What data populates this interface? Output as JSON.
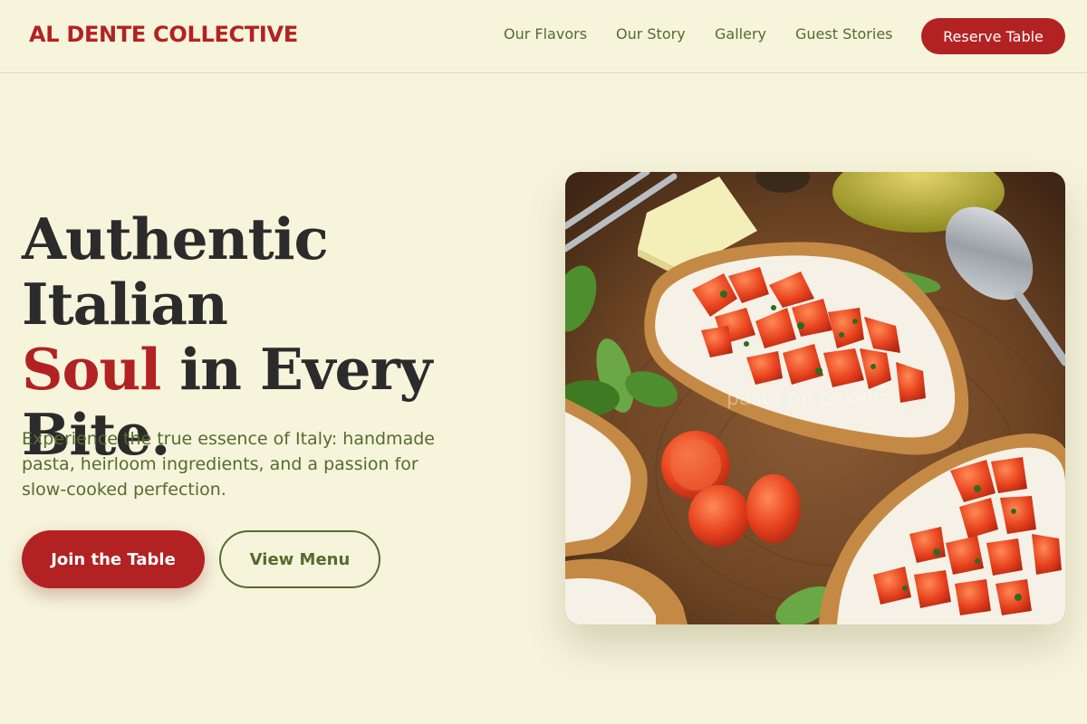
{
  "header": {
    "brand": "AL DENTE COLLECTIVE",
    "nav": [
      "Our Flavors",
      "Our Story",
      "Gallery",
      "Guest Stories"
    ],
    "cta_label": "Reserve Table"
  },
  "hero": {
    "title_line1": "Authentic Italian",
    "title_accent": "Soul",
    "title_line2_rest": " in Every",
    "title_line3": "Bite.",
    "subtitle": "Experience the true essence of Italy: handmade pasta, heirloom ingredients, and a passion for slow-cooked perfection.",
    "primary_button": "Join the Table",
    "secondary_button": "View Menu",
    "image_watermark": "pasta on pexels"
  },
  "colors": {
    "background": "#f6f4db",
    "brand_red": "#b22222",
    "olive": "#556b2f",
    "heading": "#2b2b2b"
  },
  "icons": {
    "hero_image": "bruschetta-photo"
  }
}
